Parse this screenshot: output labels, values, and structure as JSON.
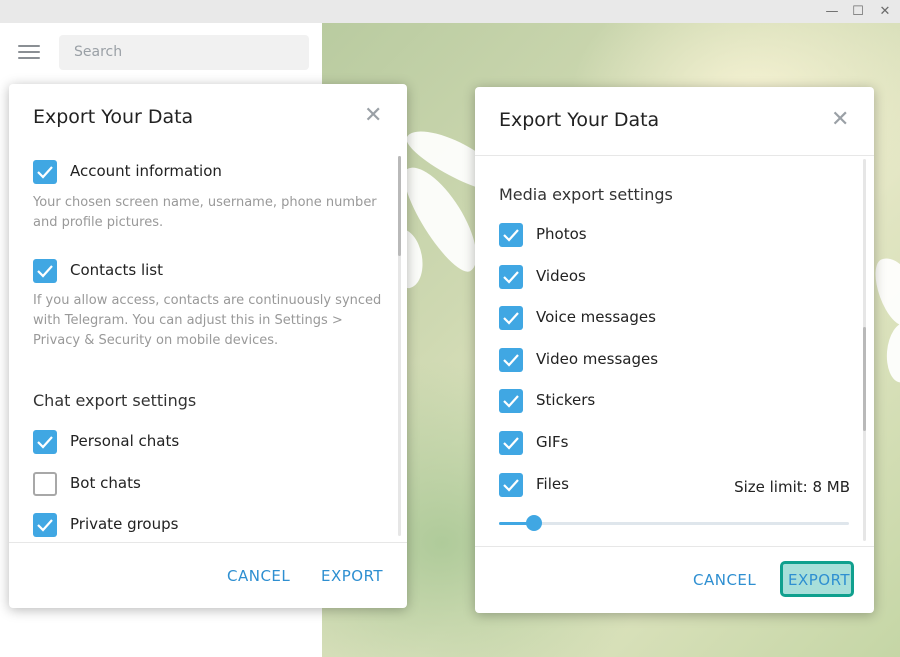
{
  "window": {
    "minimize_glyph": "—",
    "maximize_glyph": "☐",
    "close_glyph": "✕"
  },
  "sidebar": {
    "search_placeholder": "Search"
  },
  "dialog_left": {
    "title": "Export Your Data",
    "items": [
      {
        "label": "Account information",
        "checked": true,
        "description": "Your chosen screen name, username, phone number and profile pictures."
      },
      {
        "label": "Contacts list",
        "checked": true,
        "description": "If you allow access, contacts are continuously synced with Telegram. You can adjust this in Settings > Privacy & Security on mobile devices."
      }
    ],
    "section_title": "Chat export settings",
    "chat_items": [
      {
        "label": "Personal chats",
        "checked": true
      },
      {
        "label": "Bot chats",
        "checked": false
      },
      {
        "label": "Private groups",
        "checked": true
      }
    ],
    "cancel_label": "CANCEL",
    "export_label": "EXPORT"
  },
  "dialog_right": {
    "title": "Export Your Data",
    "section_title": "Media export settings",
    "media_items": [
      {
        "label": "Photos",
        "checked": true
      },
      {
        "label": "Videos",
        "checked": true
      },
      {
        "label": "Voice messages",
        "checked": true
      },
      {
        "label": "Video messages",
        "checked": true
      },
      {
        "label": "Stickers",
        "checked": true
      },
      {
        "label": "GIFs",
        "checked": true
      },
      {
        "label": "Files",
        "checked": true
      }
    ],
    "size_limit_label": "Size limit: 8 MB",
    "size_slider_fraction": 0.1,
    "cancel_label": "CANCEL",
    "export_label": "EXPORT"
  },
  "colors": {
    "accent": "#40a7e3",
    "link": "#2e8fd1",
    "highlight_border": "#10a08e",
    "highlight_fill": "#a8dfda"
  }
}
